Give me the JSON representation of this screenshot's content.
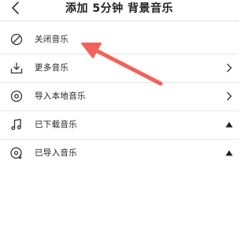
{
  "header": {
    "title": "添加 5分钟 背景音乐",
    "back_icon": "chevron-left-icon"
  },
  "menu": {
    "items": [
      {
        "label": "关闭音乐",
        "icon": "circle-slash-icon",
        "trailing": "none"
      },
      {
        "label": "更多音乐",
        "icon": "download-tray-icon",
        "trailing": "chevron-right-icon"
      },
      {
        "label": "导入本地音乐",
        "icon": "target-disc-icon",
        "trailing": "chevron-right-icon"
      },
      {
        "label": "已下载音乐",
        "icon": "music-note-icon",
        "trailing": "triangle-up-icon"
      },
      {
        "label": "已导入音乐",
        "icon": "disc-import-icon",
        "trailing": "triangle-up-icon"
      }
    ]
  },
  "annotation": {
    "arrow_color": "#f2625a"
  },
  "colors": {
    "text": "#222222",
    "divider": "#e8e8e8",
    "background": "#ffffff"
  }
}
